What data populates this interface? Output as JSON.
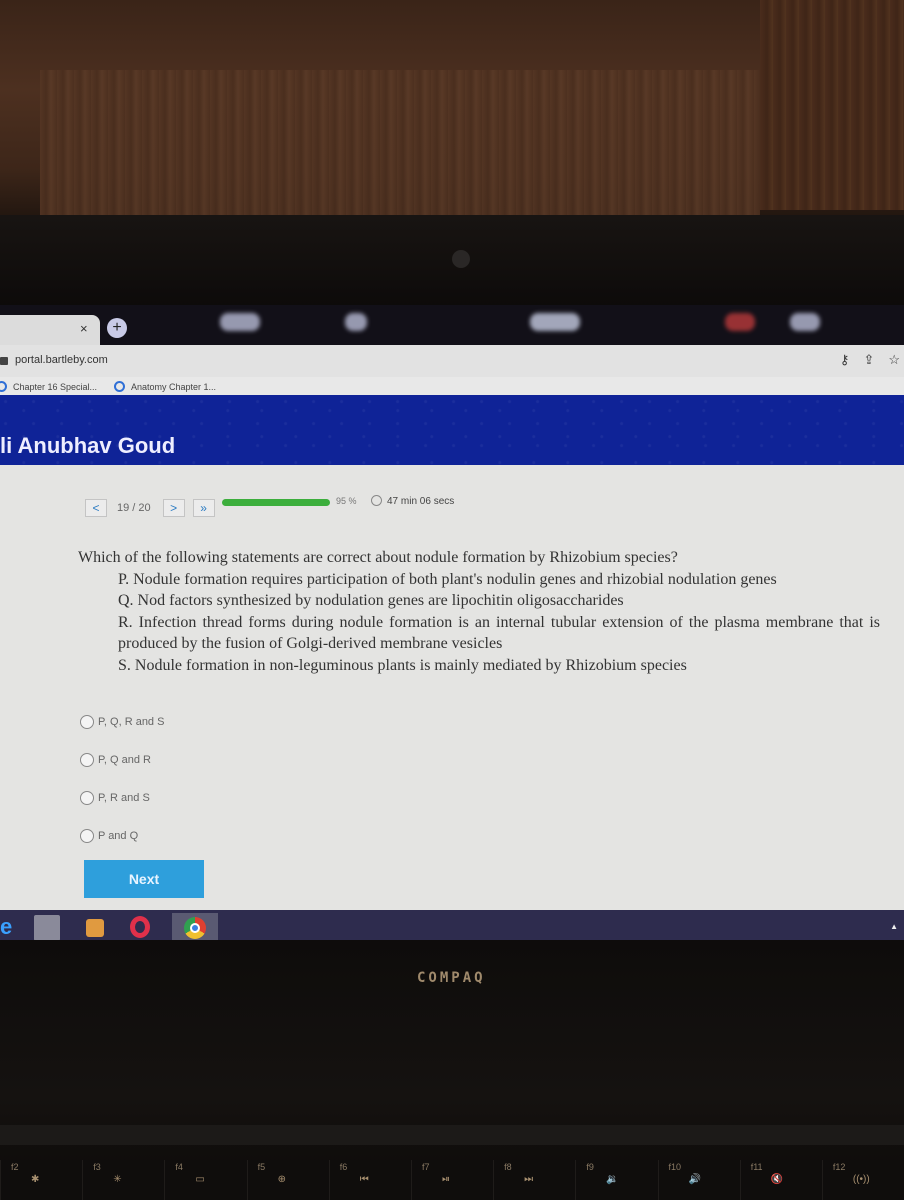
{
  "browser": {
    "tab_close": "×",
    "new_tab": "+",
    "url": "portal.bartleby.com",
    "address_icons": [
      "key-icon",
      "share-icon",
      "star-icon"
    ],
    "bookmarks": [
      {
        "label": "Chapter 16 Special...",
        "icon": "quizlet-icon"
      },
      {
        "label": "Anatomy Chapter 1...",
        "icon": "quizlet-icon"
      }
    ]
  },
  "banner": {
    "user_name": "li Anubhav Goud",
    "color": "#0f2397"
  },
  "quiz": {
    "prev_label": "<",
    "position": "19 / 20",
    "next_label": ">",
    "last_label": "»",
    "progress_percent": 95,
    "progress_text": "95 %",
    "progress_color": "#3cae3c",
    "timer": "47 min 06 secs",
    "question": "Which of the following statements are correct about nodule formation by Rhizobium species?",
    "statements": [
      "P. Nodule formation requires participation of both plant's nodulin genes and rhizobial nodulation genes",
      "Q. Nod factors synthesized by nodulation genes are lipochitin oligosaccharides",
      "R. Infection thread forms during nodule formation is an internal tubular extension of the plasma membrane that is produced by the fusion of Golgi-derived membrane vesicles",
      "S. Nodule formation in non-leguminous plants is mainly mediated by Rhizobium species"
    ],
    "options": [
      {
        "label": "P, Q, R and S",
        "selected": false
      },
      {
        "label": "P, Q and R",
        "selected": false
      },
      {
        "label": "P, R and S",
        "selected": false
      },
      {
        "label": "P and Q",
        "selected": false
      }
    ],
    "next_button": "Next",
    "next_color": "#2e9fdc"
  },
  "taskbar": {
    "items": [
      "ie-icon",
      "file-explorer-icon",
      "media-player-icon",
      "opera-icon",
      "chrome-icon"
    ],
    "tray": "▲"
  },
  "laptop": {
    "brand": "COMPAQ",
    "fkeys": [
      {
        "label": "f2",
        "symbol": "✱"
      },
      {
        "label": "f3",
        "symbol": "✳"
      },
      {
        "label": "f4",
        "symbol": "▭"
      },
      {
        "label": "f5",
        "symbol": "⊕"
      },
      {
        "label": "f6",
        "symbol": "⏮"
      },
      {
        "label": "f7",
        "symbol": "⏯"
      },
      {
        "label": "f8",
        "symbol": "⏭"
      },
      {
        "label": "f9",
        "symbol": "🔉"
      },
      {
        "label": "f10",
        "symbol": "🔊"
      },
      {
        "label": "f11",
        "symbol": "🔇"
      },
      {
        "label": "f12",
        "symbol": "((•))"
      }
    ]
  }
}
